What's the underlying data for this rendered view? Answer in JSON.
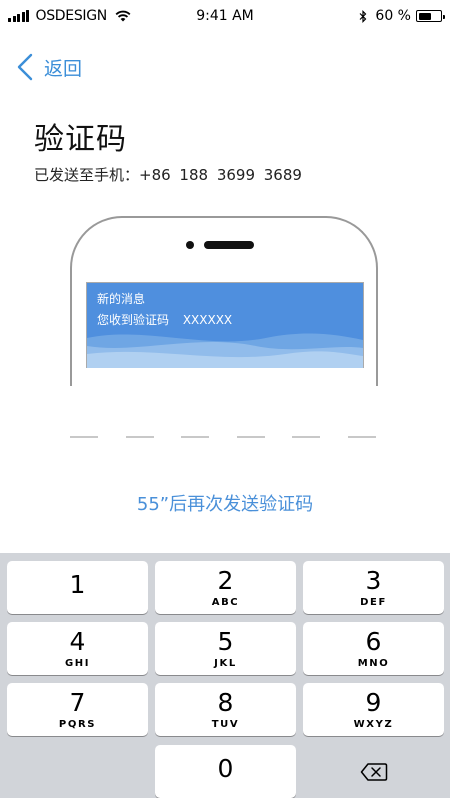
{
  "status_bar": {
    "carrier": "OSDESIGN",
    "time": "9:41 AM",
    "battery": "60 %",
    "battery_level": 0.6,
    "icons": [
      "signal-icon",
      "wifi-icon",
      "bluetooth-icon",
      "battery-icon"
    ]
  },
  "nav": {
    "back_label": "返回",
    "back_icon": "chevron-left-icon"
  },
  "page": {
    "title": "验证码",
    "subtitle": "已发送至手机：+86 188 3699 3689"
  },
  "illustration": {
    "notification_title": "新的消息",
    "notification_body": "您收到验证码 XXXXXX"
  },
  "code": {
    "slots": 6
  },
  "resend_text": "55”后再次发送验证码",
  "keypad": {
    "keys": [
      {
        "num": "1",
        "letters": ""
      },
      {
        "num": "2",
        "letters": "ABC"
      },
      {
        "num": "3",
        "letters": "DEF"
      },
      {
        "num": "4",
        "letters": "GHI"
      },
      {
        "num": "5",
        "letters": "JKL"
      },
      {
        "num": "6",
        "letters": "MNO"
      },
      {
        "num": "7",
        "letters": "PQRS"
      },
      {
        "num": "8",
        "letters": "TUV"
      },
      {
        "num": "9",
        "letters": "WXYZ"
      },
      {
        "num": "0",
        "letters": ""
      }
    ],
    "delete_icon": "backspace-icon"
  },
  "colors": {
    "accent": "#3b8ed8",
    "notification_bg": "#4f8fde",
    "keypad_bg": "#d1d4d9"
  }
}
